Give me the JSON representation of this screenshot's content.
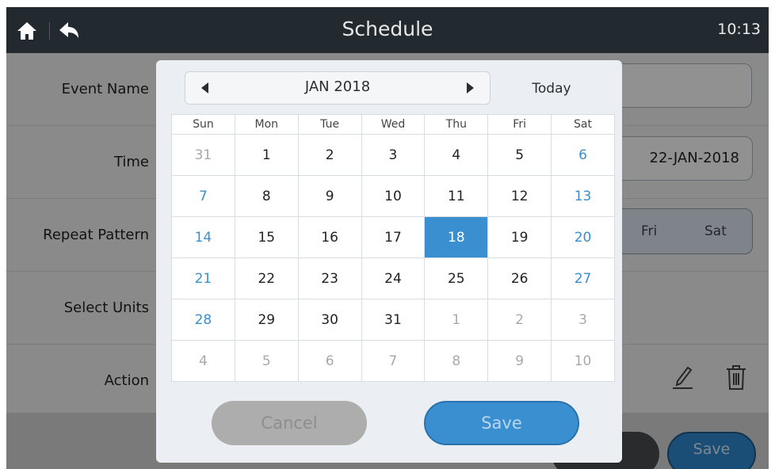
{
  "header": {
    "title": "Schedule",
    "time": "10:13",
    "home_icon": "home-icon",
    "back_icon": "back-arrow-icon"
  },
  "form": {
    "event_name_label": "Event Name",
    "time_label": "Time",
    "date_value": "22-JAN-2018",
    "repeat_label": "Repeat Pattern",
    "repeat_days_visible": [
      "Fri",
      "Sat"
    ],
    "units_label": "Select Units",
    "action_label": "Action",
    "edit_icon": "pencil-icon",
    "delete_icon": "trash-icon",
    "save_label": "Save"
  },
  "datepicker": {
    "month_label": "JAN 2018",
    "today_label": "Today",
    "weekdays": [
      "Sun",
      "Mon",
      "Tue",
      "Wed",
      "Thu",
      "Fri",
      "Sat"
    ],
    "weeks": [
      [
        {
          "d": "31",
          "k": "other"
        },
        {
          "d": "1",
          "k": "cur"
        },
        {
          "d": "2",
          "k": "cur"
        },
        {
          "d": "3",
          "k": "cur"
        },
        {
          "d": "4",
          "k": "cur"
        },
        {
          "d": "5",
          "k": "cur"
        },
        {
          "d": "6",
          "k": "weekend"
        }
      ],
      [
        {
          "d": "7",
          "k": "weekend"
        },
        {
          "d": "8",
          "k": "cur"
        },
        {
          "d": "9",
          "k": "cur"
        },
        {
          "d": "10",
          "k": "cur"
        },
        {
          "d": "11",
          "k": "cur"
        },
        {
          "d": "12",
          "k": "cur"
        },
        {
          "d": "13",
          "k": "weekend"
        }
      ],
      [
        {
          "d": "14",
          "k": "weekend"
        },
        {
          "d": "15",
          "k": "cur"
        },
        {
          "d": "16",
          "k": "cur"
        },
        {
          "d": "17",
          "k": "cur"
        },
        {
          "d": "18",
          "k": "selected"
        },
        {
          "d": "19",
          "k": "cur"
        },
        {
          "d": "20",
          "k": "weekend"
        }
      ],
      [
        {
          "d": "21",
          "k": "weekend"
        },
        {
          "d": "22",
          "k": "cur"
        },
        {
          "d": "23",
          "k": "cur"
        },
        {
          "d": "24",
          "k": "cur"
        },
        {
          "d": "25",
          "k": "cur"
        },
        {
          "d": "26",
          "k": "cur"
        },
        {
          "d": "27",
          "k": "weekend"
        }
      ],
      [
        {
          "d": "28",
          "k": "weekend"
        },
        {
          "d": "29",
          "k": "cur"
        },
        {
          "d": "30",
          "k": "cur"
        },
        {
          "d": "31",
          "k": "cur"
        },
        {
          "d": "1",
          "k": "other"
        },
        {
          "d": "2",
          "k": "other"
        },
        {
          "d": "3",
          "k": "other"
        }
      ],
      [
        {
          "d": "4",
          "k": "other"
        },
        {
          "d": "5",
          "k": "other"
        },
        {
          "d": "6",
          "k": "other"
        },
        {
          "d": "7",
          "k": "other"
        },
        {
          "d": "8",
          "k": "other"
        },
        {
          "d": "9",
          "k": "other"
        },
        {
          "d": "10",
          "k": "other"
        }
      ]
    ],
    "cancel_label": "Cancel",
    "save_label": "Save",
    "prev_icon": "caret-left-icon",
    "next_icon": "caret-right-icon"
  },
  "colors": {
    "accent": "#3a8fd0",
    "topbar": "#222a30",
    "weekend_text": "#3a8fd0",
    "other_month_text": "#a9a9a9"
  }
}
